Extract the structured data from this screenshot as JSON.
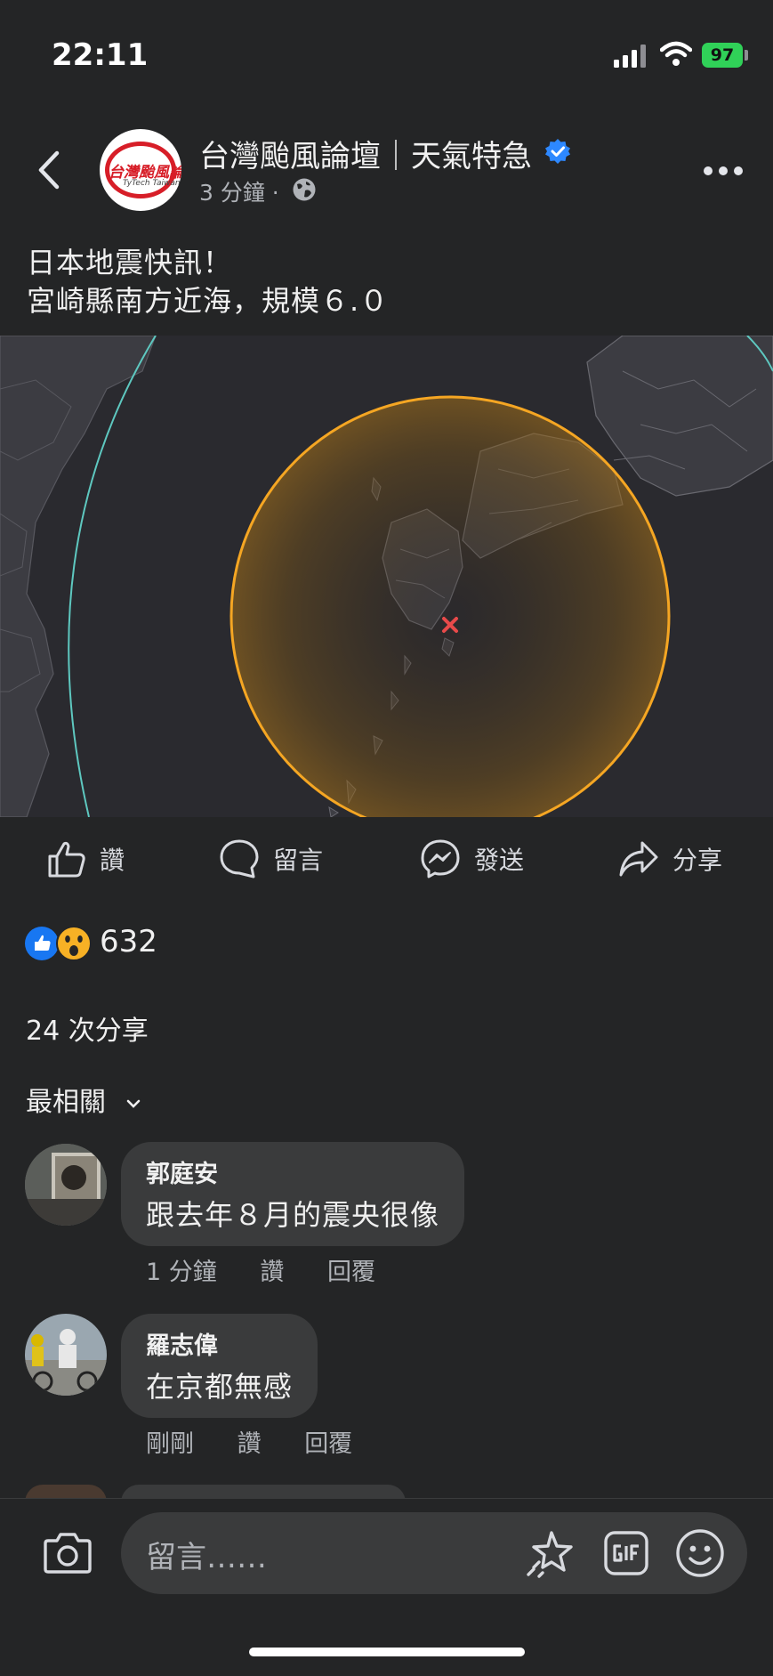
{
  "status_bar": {
    "time": "22:11",
    "battery": "97",
    "signal_icon": "signal-bars-icon",
    "wifi_icon": "wifi-icon"
  },
  "header": {
    "page_name": "台灣颱風論壇｜天氣特急",
    "logo_text": "台灣颱風論壇",
    "logo_subtext": "TyTech Taiwan",
    "post_time": "3 分鐘 ·",
    "verified_color": "#2d88ff"
  },
  "post": {
    "line1": "日本地震快訊！",
    "line2": "宮崎縣南方近海，規模６.０"
  },
  "map": {
    "description_colors": {
      "circle": "#f5a623",
      "epicenter": "#e84a4a",
      "land": "#3a3a40",
      "sea": "#2a2a2f",
      "boundary": "#5ec8c0"
    }
  },
  "actions": {
    "like": "讚",
    "comment": "留言",
    "send": "發送",
    "share": "分享"
  },
  "stats": {
    "reaction_count": "632",
    "shares": "24 次分享"
  },
  "sort": {
    "label": "最相關"
  },
  "comments": [
    {
      "author": "郭庭安",
      "text": "跟去年８月的震央很像",
      "time": "1 分鐘",
      "like": "讚",
      "reply": "回覆"
    },
    {
      "author": "羅志偉",
      "text": "在京都無感",
      "time": "剛剛",
      "like": "讚",
      "reply": "回覆"
    }
  ],
  "composer": {
    "placeholder": "留言……"
  }
}
